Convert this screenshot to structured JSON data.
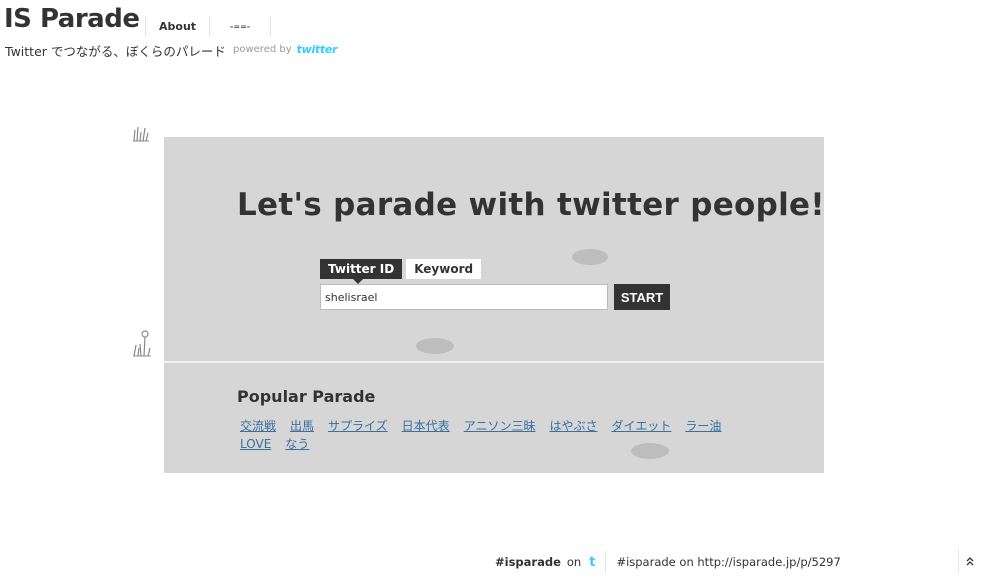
{
  "header": {
    "site_title": "IS Parade",
    "nav": [
      {
        "label": "About"
      },
      {
        "label": "-==-"
      }
    ],
    "tagline": "Twitter でつながる、ぼくらのパレード",
    "powered_by": "powered by",
    "twitter_logo": "twitter"
  },
  "main": {
    "headline": "Let's parade with twitter people!",
    "tabs": [
      {
        "label": "Twitter ID",
        "active": true
      },
      {
        "label": "Keyword",
        "active": false
      }
    ],
    "id_input_value": "shelisrael",
    "start_label": "START",
    "popular_title": "Popular Parade",
    "keywords": [
      "交流戦",
      "出馬",
      "サプライズ",
      "日本代表",
      "アニソン三昧",
      "はやぶさ",
      "ダイエット",
      "ラー油",
      "LOVE",
      "なう"
    ]
  },
  "footer": {
    "hashtag": "#isparade",
    "on": "on",
    "twitter_icon": "t",
    "share_text": "#isparade on http://isparade.jp/p/5297",
    "scroll_top_icon": "chevron-double-up-icon"
  },
  "colors": {
    "panel_bg": "#d6d6d6",
    "dark": "#333333",
    "link": "#3a6f9e",
    "twitter_blue": "#33ccff"
  }
}
